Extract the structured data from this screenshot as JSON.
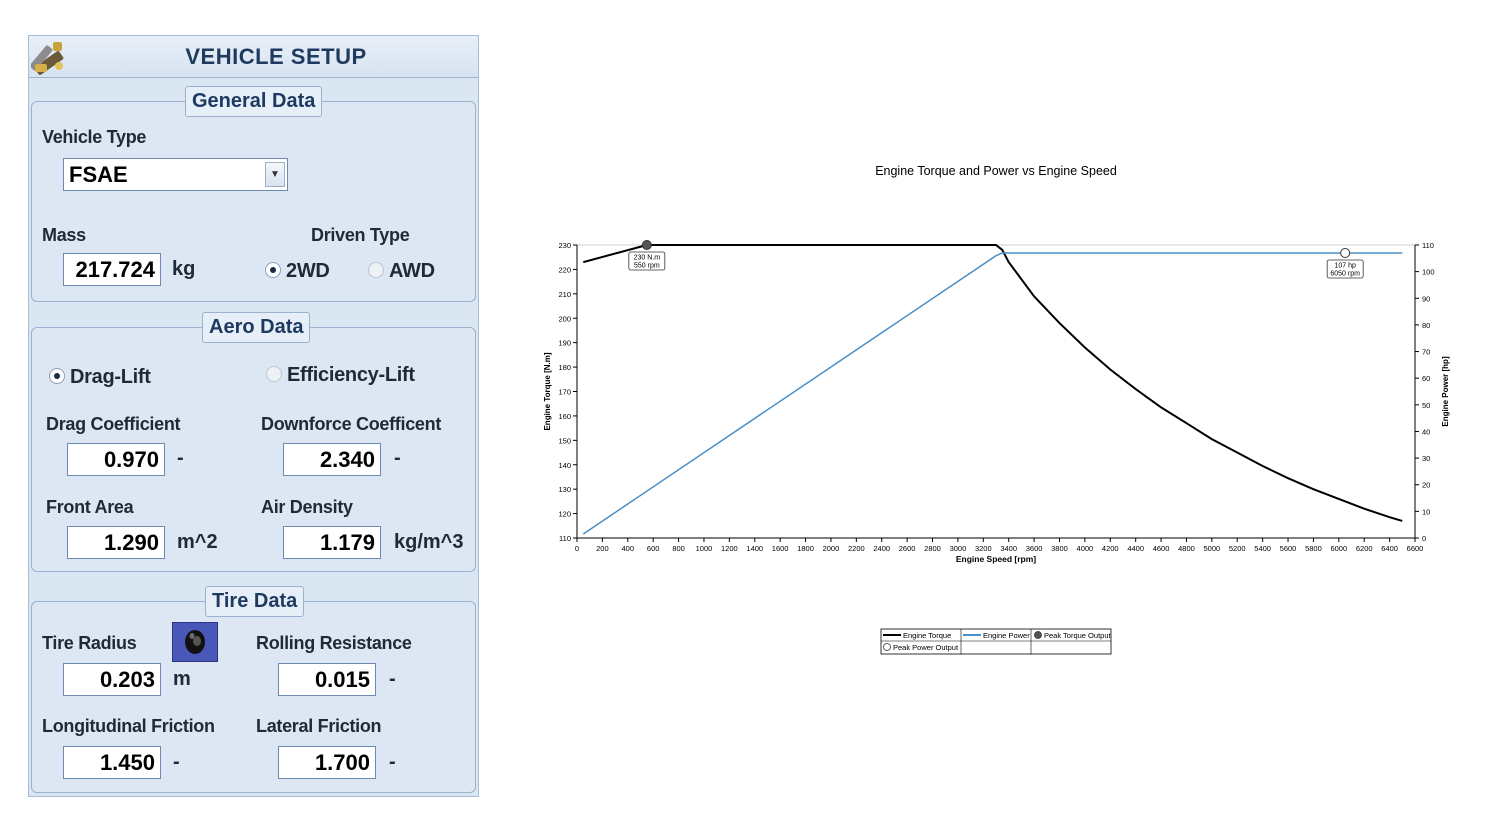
{
  "panel": {
    "title": "VEHICLE SETUP",
    "icon": "tools-icon",
    "general": {
      "legend": "General Data",
      "vehicle_type_label": "Vehicle Type",
      "vehicle_type_value": "FSAE",
      "mass_label": "Mass",
      "mass_value": "217.724",
      "mass_unit": "kg",
      "driven_type_label": "Driven Type",
      "driven_options": [
        {
          "label": "2WD",
          "selected": true
        },
        {
          "label": "AWD",
          "selected": false
        }
      ]
    },
    "aero": {
      "legend": "Aero Data",
      "mode_options": [
        {
          "label": "Drag-Lift",
          "selected": true
        },
        {
          "label": "Efficiency-Lift",
          "selected": false
        }
      ],
      "drag_label": "Drag Coefficient",
      "drag_value": "0.970",
      "drag_unit": "-",
      "downforce_label": "Downforce Coefficent",
      "downforce_value": "2.340",
      "downforce_unit": "-",
      "area_label": "Front Area",
      "area_value": "1.290",
      "area_unit": "m^2",
      "density_label": "Air Density",
      "density_value": "1.179",
      "density_unit": "kg/m^3"
    },
    "tire": {
      "legend": "Tire Data",
      "radius_label": "Tire Radius",
      "radius_value": "0.203",
      "radius_unit": "m",
      "rolling_label": "Rolling Resistance",
      "rolling_value": "0.015",
      "rolling_unit": "-",
      "long_label": "Longitudinal Friction",
      "long_value": "1.450",
      "long_unit": "-",
      "lat_label": "Lateral Friction",
      "lat_value": "1.700",
      "lat_unit": "-"
    }
  },
  "chart_data": {
    "type": "line",
    "title": "Engine Torque and Power vs Engine Speed",
    "xlabel": "Engine Speed [rpm]",
    "ylabel": "Engine Torque [N.m]",
    "y2label": "Engine Power [hp]",
    "xlim": [
      0,
      6600
    ],
    "ylim": [
      110,
      230
    ],
    "y2lim": [
      0,
      110
    ],
    "x_ticks": [
      0,
      200,
      400,
      600,
      800,
      1000,
      1200,
      1400,
      1600,
      1800,
      2000,
      2200,
      2400,
      2600,
      2800,
      3000,
      3200,
      3400,
      3600,
      3800,
      4000,
      4200,
      4400,
      4600,
      4800,
      5000,
      5200,
      5400,
      5600,
      5800,
      6000,
      6200,
      6400,
      6600
    ],
    "y_ticks": [
      110,
      120,
      130,
      140,
      150,
      160,
      170,
      180,
      190,
      200,
      210,
      220,
      230
    ],
    "y2_ticks": [
      0,
      10,
      20,
      30,
      40,
      50,
      60,
      70,
      80,
      90,
      100,
      110
    ],
    "series": [
      {
        "name": "Engine Torque",
        "axis": "left",
        "color": "#000000",
        "x": [
          50,
          550,
          3300,
          3350,
          3400,
          3600,
          3800,
          4000,
          4200,
          4400,
          4600,
          4800,
          5000,
          5200,
          5400,
          5600,
          5800,
          6000,
          6200,
          6400,
          6500
        ],
        "y": [
          223,
          230,
          230,
          228,
          223,
          209,
          198,
          188,
          179,
          171,
          163.5,
          157,
          150.5,
          145,
          139.5,
          134.5,
          130,
          126,
          122,
          118.5,
          117
        ]
      },
      {
        "name": "Engine Power",
        "axis": "right",
        "color": "#4a90c8",
        "x": [
          50,
          3300,
          3350,
          6500
        ],
        "y": [
          1.5,
          106,
          107,
          107
        ]
      }
    ],
    "markers": [
      {
        "name": "Peak Torque Output",
        "x": 550,
        "y": 230,
        "axis": "left",
        "fill": "#555555",
        "label_lines": [
          "230 N.m",
          "550 rpm"
        ]
      },
      {
        "name": "Peak Power Output",
        "x": 6050,
        "y": 107,
        "axis": "right",
        "fill": "#ffffff",
        "label_lines": [
          "107 hp",
          "6050 rpm"
        ]
      }
    ],
    "legend": [
      "Engine Torque",
      "Engine Power",
      "Peak Torque Output",
      "Peak Power Output"
    ],
    "legend_position": "bottom-center",
    "grid": false
  }
}
